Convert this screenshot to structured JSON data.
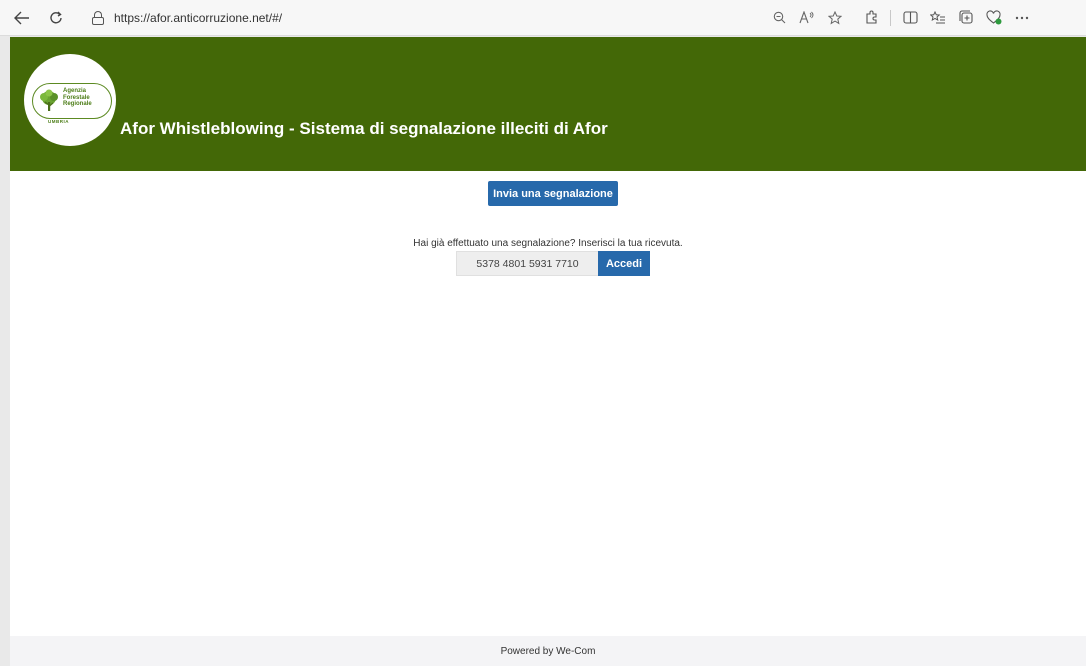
{
  "browser": {
    "url": "https://afor.anticorruzione.net/#/",
    "icons": {
      "back": "back-arrow-icon",
      "reload": "reload-icon",
      "lock": "lock-icon",
      "zoom": "zoom-out-icon",
      "read_aloud": "read-aloud-icon",
      "favorite": "star-icon",
      "extensions": "extensions-icon",
      "split": "split-screen-icon",
      "favorites": "favorites-list-icon",
      "collections": "collections-icon",
      "performance": "browser-essentials-icon",
      "more": "more-icon"
    }
  },
  "header": {
    "title": "Afor Whistleblowing - Sistema di segnalazione illeciti di Afor",
    "background": "#436807",
    "logo": {
      "line1": "Agenzia",
      "line2": "Forestale",
      "line3": "Regionale",
      "region": "UMBRIA"
    }
  },
  "main": {
    "submit_button": "Invia una segnalazione",
    "receipt_prompt": "Hai già effettuato una segnalazione? Inserisci la tua ricevuta.",
    "receipt_value": "5378 4801 5931 7710",
    "login_button": "Accedi",
    "accent": "#2769ab"
  },
  "footer": {
    "text": "Powered by We-Com"
  }
}
